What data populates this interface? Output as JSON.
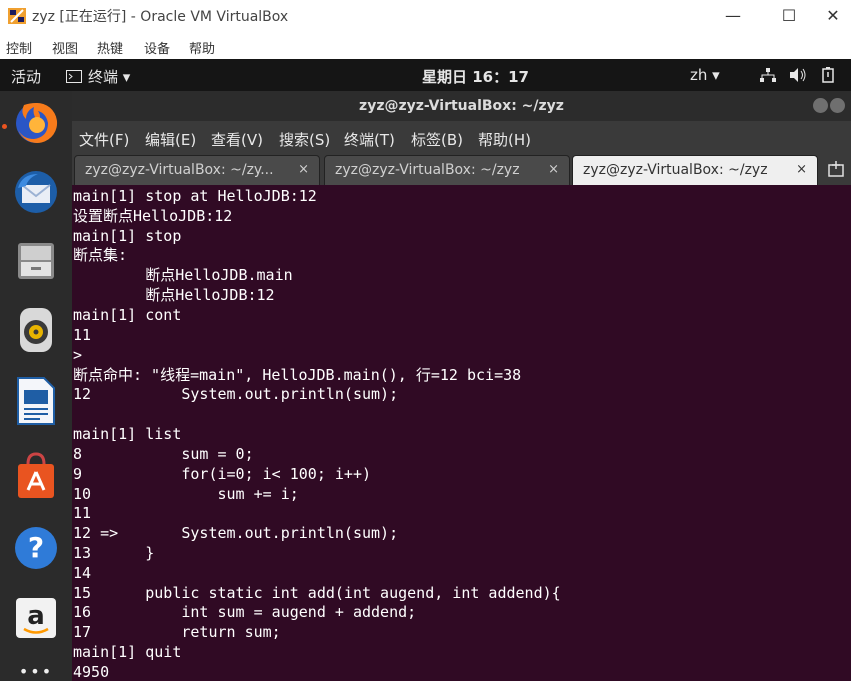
{
  "host_window": {
    "title": "zyz [正在运行] - Oracle VM VirtualBox",
    "minimize": "—",
    "maximize": "☐",
    "close": "✕",
    "menu": [
      "控制",
      "视图",
      "热键",
      "设备",
      "帮助"
    ]
  },
  "topbar": {
    "activities": "活动",
    "app_menu": "终端 ▾",
    "clock": "星期日 16：17",
    "input_method": "zh ▾"
  },
  "dock": {
    "items": [
      "firefox",
      "thunderbird",
      "files",
      "rhythmbox",
      "libreoffice-writer",
      "ubuntu-software",
      "help",
      "amazon"
    ],
    "more": "•••"
  },
  "terminal": {
    "title": "zyz@zyz-VirtualBox: ~/zyz",
    "menu": [
      "文件(F)",
      "编辑(E)",
      "查看(V)",
      "搜索(S)",
      "终端(T)",
      "标签(B)",
      "帮助(H)"
    ],
    "tabs": [
      {
        "label": "zyz@zyz-VirtualBox: ~/zy...",
        "close": "×"
      },
      {
        "label": "zyz@zyz-VirtualBox: ~/zyz",
        "close": "×"
      },
      {
        "label": "zyz@zyz-VirtualBox: ~/zyz",
        "close": "×"
      }
    ],
    "lines": [
      "main[1] stop at HelloJDB:12",
      "设置断点HelloJDB:12",
      "main[1] stop",
      "断点集:",
      "        断点HelloJDB.main",
      "        断点HelloJDB:12",
      "main[1] cont",
      "11",
      ">",
      "断点命中: \"线程=main\", HelloJDB.main(), 行=12 bci=38",
      "12          System.out.println(sum);",
      "",
      "main[1] list",
      "8           sum = 0;",
      "9           for(i=0; i< 100; i++)",
      "10              sum += i;",
      "11",
      "12 =>       System.out.println(sum);",
      "13      }",
      "14",
      "15      public static int add(int augend, int addend){",
      "16          int sum = augend + addend;",
      "17          return sum;",
      "main[1] quit",
      "4950"
    ]
  }
}
